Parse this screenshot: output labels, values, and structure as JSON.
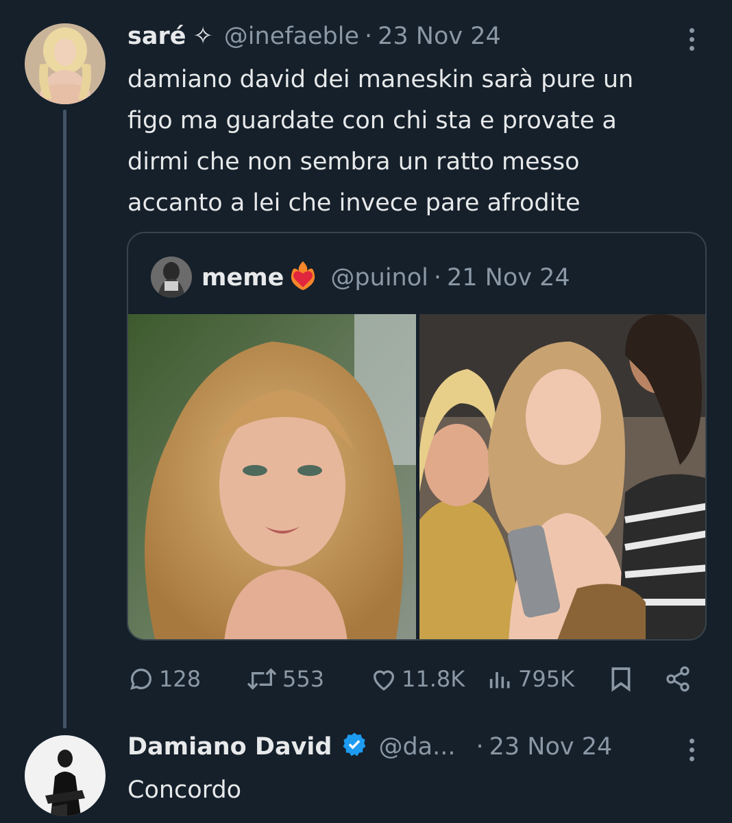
{
  "tweet": {
    "author_name": "saré",
    "author_symbol": "✧",
    "handle": "@inefaeble",
    "separator": "·",
    "date": "23 Nov 24",
    "text": "damiano david dei maneskin sarà pure un\nfigo ma guardate con chi sta e provate a\ndirmi che non sembra un ratto messo\naccanto a lei che invece pare afrodite"
  },
  "quote": {
    "author_name": "meme",
    "badge_icon": "heart-on-fire-emoji",
    "handle": "@puinol",
    "separator": "·",
    "date": "21 Nov 24",
    "media": [
      {
        "icon": "photo-portrait"
      },
      {
        "icon": "photo-group"
      }
    ]
  },
  "actions": {
    "replies": "128",
    "reposts": "553",
    "likes": "11.8K",
    "views": "795K",
    "icons": [
      "reply-icon",
      "repost-icon",
      "like-icon",
      "views-icon",
      "bookmark-icon",
      "share-icon"
    ]
  },
  "reply": {
    "author_name": "Damiano David",
    "verified": true,
    "handle": "@da...",
    "separator": "·",
    "date": "23 Nov 24",
    "text": "Concordo"
  },
  "colors": {
    "background": "#15202b",
    "text": "#e7e9ea",
    "muted": "#8b98a5",
    "border": "#38444d",
    "verified": "#1d9bf0"
  }
}
